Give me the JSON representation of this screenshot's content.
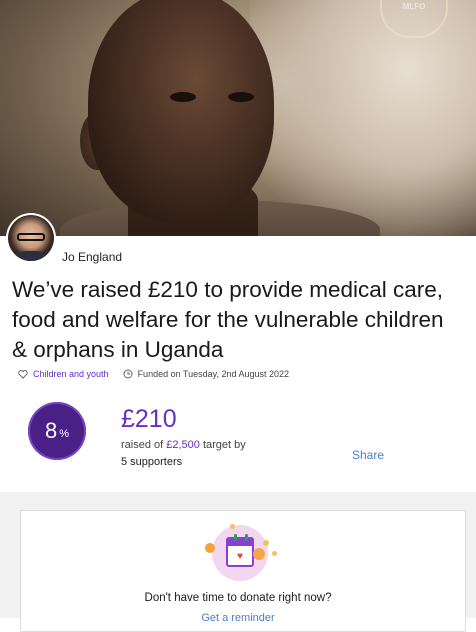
{
  "hero": {
    "logo_text": "MLFO"
  },
  "author": {
    "name": "Jo England"
  },
  "page": {
    "title": "We’ve raised £210 to provide medical care, food and welfare for the vulnerable children & orphans in Uganda"
  },
  "meta": {
    "category": "Children and youth",
    "funded": "Funded on Tuesday, 2nd August 2022"
  },
  "progress": {
    "percent": "8",
    "percent_unit": "%",
    "percent_value": 8,
    "raised": "£210",
    "raised_prefix": "raised of ",
    "target": "£2,500",
    "raised_suffix": " target by",
    "supporters": "5 supporters",
    "share_label": "Share"
  },
  "cta": {
    "text": "Don't have time to donate right now?",
    "link": "Get a reminder"
  },
  "colors": {
    "accent": "#6a2fc2",
    "circle": "#4a1f86",
    "link": "#4b7fc9"
  },
  "icons": {
    "category": "heart-outline-icon",
    "funded": "clock-icon",
    "calendar": "calendar-heart-icon"
  }
}
